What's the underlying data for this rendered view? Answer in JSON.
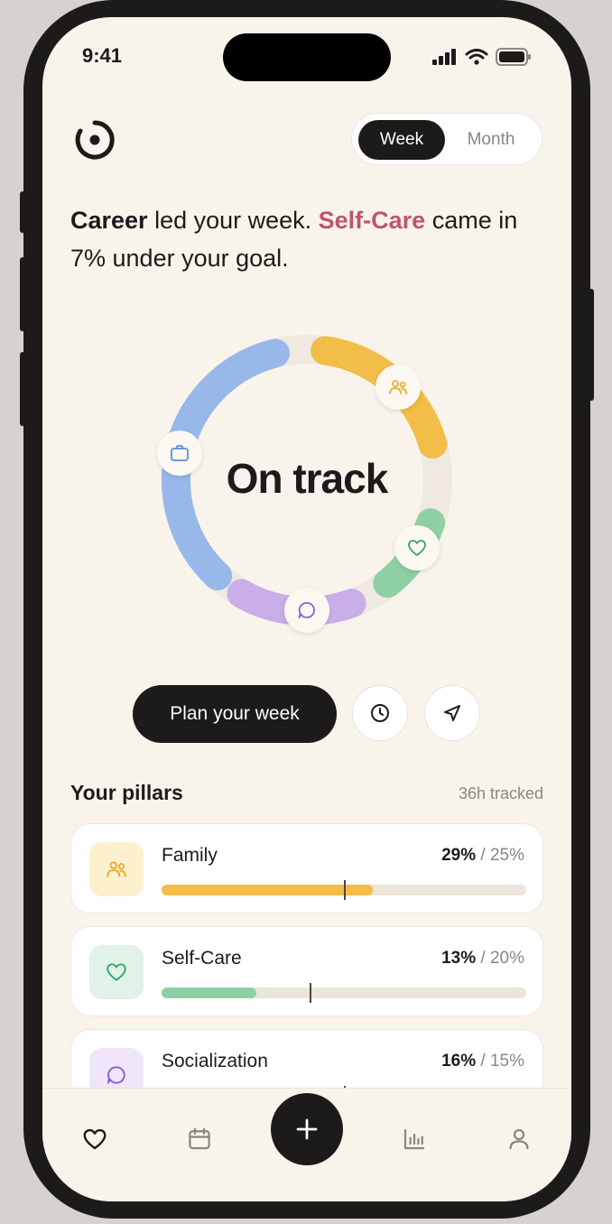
{
  "status": {
    "time": "9:41"
  },
  "period_toggle": {
    "week_label": "Week",
    "month_label": "Month",
    "selected": "Week"
  },
  "headline": {
    "lead": "Career",
    "part1": " led your week. ",
    "highlight": "Self-Care",
    "part2": " came in 7% under your goal."
  },
  "ring": {
    "label": "On track"
  },
  "actions": {
    "plan_label": "Plan your week"
  },
  "pillars_section": {
    "title": "Your pillars",
    "meta": "36h tracked"
  },
  "pillars": [
    {
      "name": "Family",
      "actual": "29%",
      "goal": "/ 25%",
      "fill": 0.58,
      "goal_pos": 0.5,
      "color": "#f2bd48",
      "tile": "#fdf0cf",
      "icon": "people-icon"
    },
    {
      "name": "Self-Care",
      "actual": "13%",
      "goal": "/ 20%",
      "fill": 0.26,
      "goal_pos": 0.405,
      "color": "#8fcfa6",
      "tile": "#e1f2e7",
      "icon": "heart-icon"
    },
    {
      "name": "Socialization",
      "actual": "16%",
      "goal": "/ 15%",
      "fill": 0.53,
      "goal_pos": 0.5,
      "color": "#c9aee9",
      "tile": "#efe7f9",
      "icon": "chat-icon"
    }
  ],
  "colors": {
    "career": "#97b8e8",
    "family": "#f2bd48",
    "selfcare": "#8fcfa6",
    "socialization": "#c9aee9",
    "accent": "#c0546b"
  }
}
